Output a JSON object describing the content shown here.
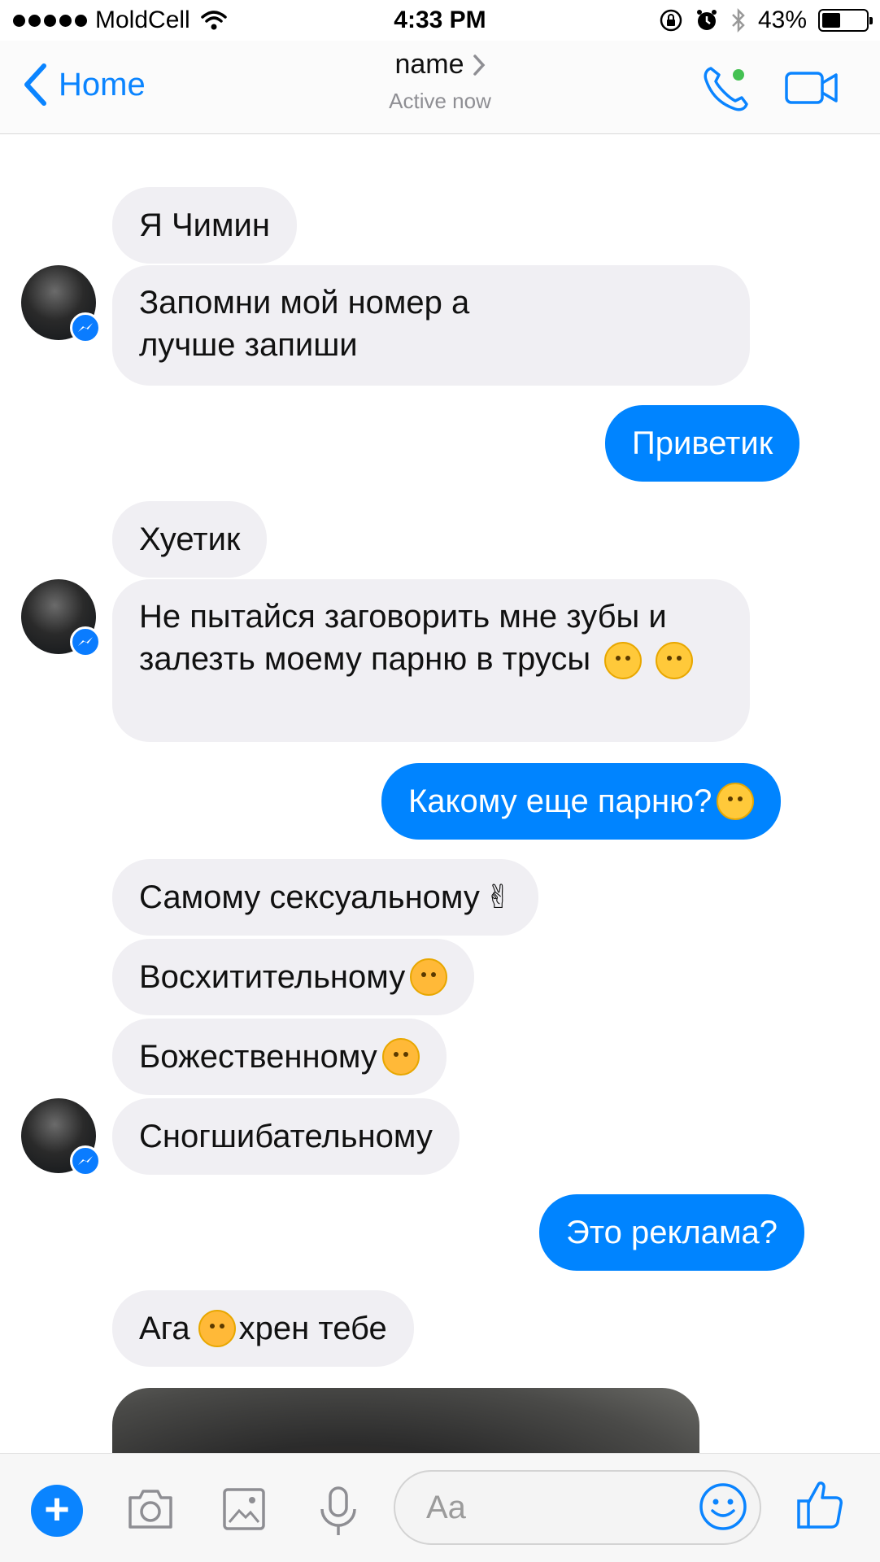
{
  "status_bar": {
    "carrier": "MoldCell",
    "time": "4:33 PM",
    "battery_percent": "43%",
    "battery_level": 0.43
  },
  "nav": {
    "back_label": "Home",
    "contact_name": "name",
    "status": "Active now"
  },
  "messages": [
    {
      "dir": "in",
      "text": "Я Чимин"
    },
    {
      "dir": "in",
      "text": "Запомни мой номер а лучше запиши"
    },
    {
      "dir": "out",
      "text": "Приветик"
    },
    {
      "dir": "in",
      "text": "Хуетик"
    },
    {
      "dir": "in",
      "text": "Не пытайся заговорить мне зубы и залезть моему парню в трусы"
    },
    {
      "dir": "out",
      "text": "Какому еще парню?"
    },
    {
      "dir": "in",
      "text": "Самому сексуальному"
    },
    {
      "dir": "in",
      "text": "Восхитительному"
    },
    {
      "dir": "in",
      "text": "Божественному"
    },
    {
      "dir": "in",
      "text": "Сногшибательному"
    },
    {
      "dir": "out",
      "text": "Это реклама?"
    },
    {
      "dir": "in",
      "text_before": "Ага",
      "text_after": "хрен тебе"
    }
  ],
  "composer": {
    "placeholder": "Aa"
  },
  "icons": {
    "back": "chevron-left-icon",
    "call": "phone-icon",
    "video": "video-camera-icon",
    "plus": "plus-icon",
    "camera": "camera-icon",
    "gallery": "image-icon",
    "mic": "microphone-icon",
    "emoji": "smiley-icon",
    "like": "thumbs-up-icon"
  },
  "colors": {
    "accent": "#0084ff",
    "incoming_bubble": "#f0eff3",
    "online_dot": "#44c152"
  }
}
